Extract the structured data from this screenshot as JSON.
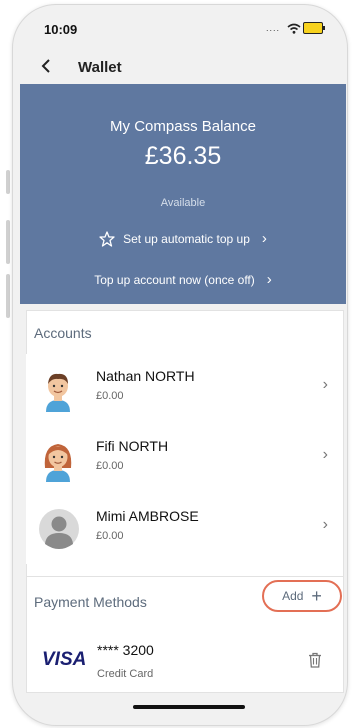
{
  "status_bar": {
    "time": "10:09",
    "signal": "....",
    "wifi_icon": "wifi-icon",
    "battery_icon": "battery-charging-icon"
  },
  "nav": {
    "back_icon": "chevron-left-icon",
    "title": "Wallet"
  },
  "balance": {
    "label": "My Compass Balance",
    "amount": "£36.35",
    "availability": "Available",
    "auto_top_up_label": "Set up automatic top up",
    "once_off_top_up_label": "Top up account now (once off)",
    "hero_color": "#5f78a0"
  },
  "accounts": {
    "heading": "Accounts",
    "items": [
      {
        "name": "Nathan NORTH",
        "balance": "£0.00",
        "avatar": "boy-avatar-icon"
      },
      {
        "name": "Fifi NORTH",
        "balance": "£0.00",
        "avatar": "girl-avatar-icon"
      },
      {
        "name": "Mimi AMBROSE",
        "balance": "£0.00",
        "avatar": "default-person-avatar-icon"
      }
    ]
  },
  "payment_methods": {
    "heading": "Payment Methods",
    "add_label": "Add",
    "add_highlight_color": "#e36f55",
    "cards": [
      {
        "brand": "VISA",
        "number": "**** 3200",
        "type": "Credit Card"
      }
    ]
  }
}
